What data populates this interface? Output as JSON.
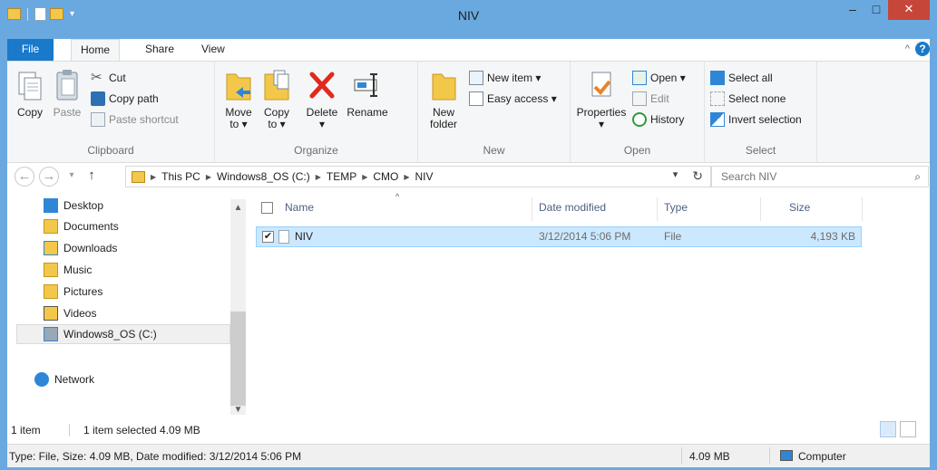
{
  "window": {
    "title": "NIV",
    "minimize": "–",
    "maximize": "□",
    "close": "✕"
  },
  "ribbon_tabs": {
    "file": "File",
    "home": "Home",
    "share": "Share",
    "view": "View",
    "collapse": "^",
    "help": "?"
  },
  "clipboard": {
    "copy": "Copy",
    "paste": "Paste",
    "cut": "Cut",
    "copy_path": "Copy path",
    "paste_shortcut": "Paste shortcut",
    "label": "Clipboard"
  },
  "organize": {
    "move_to": "Move",
    "move_to2": "to ▾",
    "copy_to": "Copy",
    "copy_to2": "to ▾",
    "delete": "Delete",
    "delete_arrow": "▾",
    "rename": "Rename",
    "label": "Organize"
  },
  "new": {
    "new_folder": "New",
    "new_folder2": "folder",
    "new_item": "New item ▾",
    "easy_access": "Easy access ▾",
    "label": "New"
  },
  "open": {
    "properties": "Properties",
    "properties_arrow": "▾",
    "open": "Open ▾",
    "edit": "Edit",
    "history": "History",
    "label": "Open"
  },
  "select": {
    "select_all": "Select all",
    "select_none": "Select none",
    "invert": "Invert selection",
    "label": "Select"
  },
  "address": {
    "back": "←",
    "forward": "→",
    "recent": "▾",
    "up": "↑",
    "crumbs": [
      "This PC",
      "Windows8_OS (C:)",
      "TEMP",
      "CMO",
      "NIV"
    ],
    "dropdown": "▾",
    "refresh": "↻"
  },
  "search": {
    "placeholder": "Search NIV",
    "icon": "⌕"
  },
  "nav": {
    "items": [
      "Desktop",
      "Documents",
      "Downloads",
      "Music",
      "Pictures",
      "Videos",
      "Windows8_OS (C:)",
      "Network"
    ]
  },
  "columns": {
    "name": "Name",
    "date": "Date modified",
    "type": "Type",
    "size": "Size",
    "sort": "^"
  },
  "files": [
    {
      "name": "NIV",
      "date": "3/12/2014 5:06 PM",
      "type": "File",
      "size": "4,193 KB",
      "checked": "✔"
    }
  ],
  "status": {
    "count": "1 item",
    "selected": "1 item selected  4.09 MB",
    "details": "Type: File, Size: 4.09 MB, Date modified: 3/12/2014 5:06 PM",
    "size": "4.09 MB",
    "location": "Computer"
  },
  "colors": {
    "title_bar": "#6aa9e0",
    "file_tab": "#1979ca",
    "selection": "#cce8ff",
    "close": "#c7463a"
  }
}
